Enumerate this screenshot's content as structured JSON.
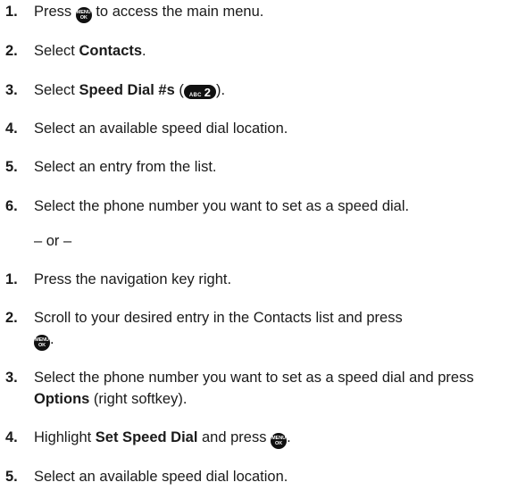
{
  "icons": {
    "menu_ok_key": {
      "name": "menu-ok-key-icon",
      "top": "MENU",
      "bottom": "OK"
    },
    "abc2_key": {
      "name": "abc-2-key-icon",
      "small": "ABC",
      "big": "2"
    }
  },
  "first_method": [
    {
      "num": "1.",
      "before": "Press ",
      "after": " to access the main menu."
    },
    {
      "num": "2.",
      "before": "Select ",
      "bold": "Contacts",
      "after": "."
    },
    {
      "num": "3.",
      "before": "Select ",
      "bold": "Speed Dial #s",
      "after_bold": " (",
      "after": ")."
    },
    {
      "num": "4.",
      "text": "Select an available speed dial location."
    },
    {
      "num": "5.",
      "text": "Select an entry from the list."
    },
    {
      "num": "6.",
      "text": "Select the phone number you want to set as a speed dial."
    }
  ],
  "separator": "– or –",
  "second_method": [
    {
      "num": "1.",
      "text": "Press the navigation key right."
    },
    {
      "num": "2.",
      "before": "Scroll to your desired entry in the Contacts list and press",
      "after": "."
    },
    {
      "num": "3.",
      "before": "Select the phone number you want to set as a speed dial and press ",
      "bold": "Options",
      "after": " (right softkey)."
    },
    {
      "num": "4.",
      "before": "Highlight ",
      "bold": "Set Speed Dial",
      "middle": " and press ",
      "after": "."
    },
    {
      "num": "5.",
      "text": "Select an available speed dial location."
    }
  ]
}
